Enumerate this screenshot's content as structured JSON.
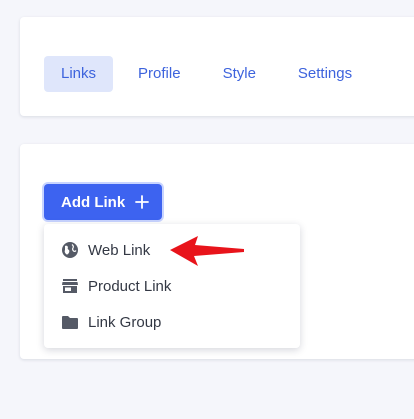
{
  "tabs": [
    {
      "label": "Links",
      "active": true
    },
    {
      "label": "Profile",
      "active": false
    },
    {
      "label": "Style",
      "active": false
    },
    {
      "label": "Settings",
      "active": false
    }
  ],
  "add_button": {
    "label": "Add Link",
    "icon": "plus-icon"
  },
  "menu": {
    "items": [
      {
        "label": "Web Link",
        "icon": "globe-icon"
      },
      {
        "label": "Product Link",
        "icon": "store-icon"
      },
      {
        "label": "Link Group",
        "icon": "folder-icon"
      }
    ]
  },
  "colors": {
    "accent": "#3d63f0",
    "tab_active_bg": "#dfe6fb",
    "annotation_arrow": "#e8141b"
  }
}
